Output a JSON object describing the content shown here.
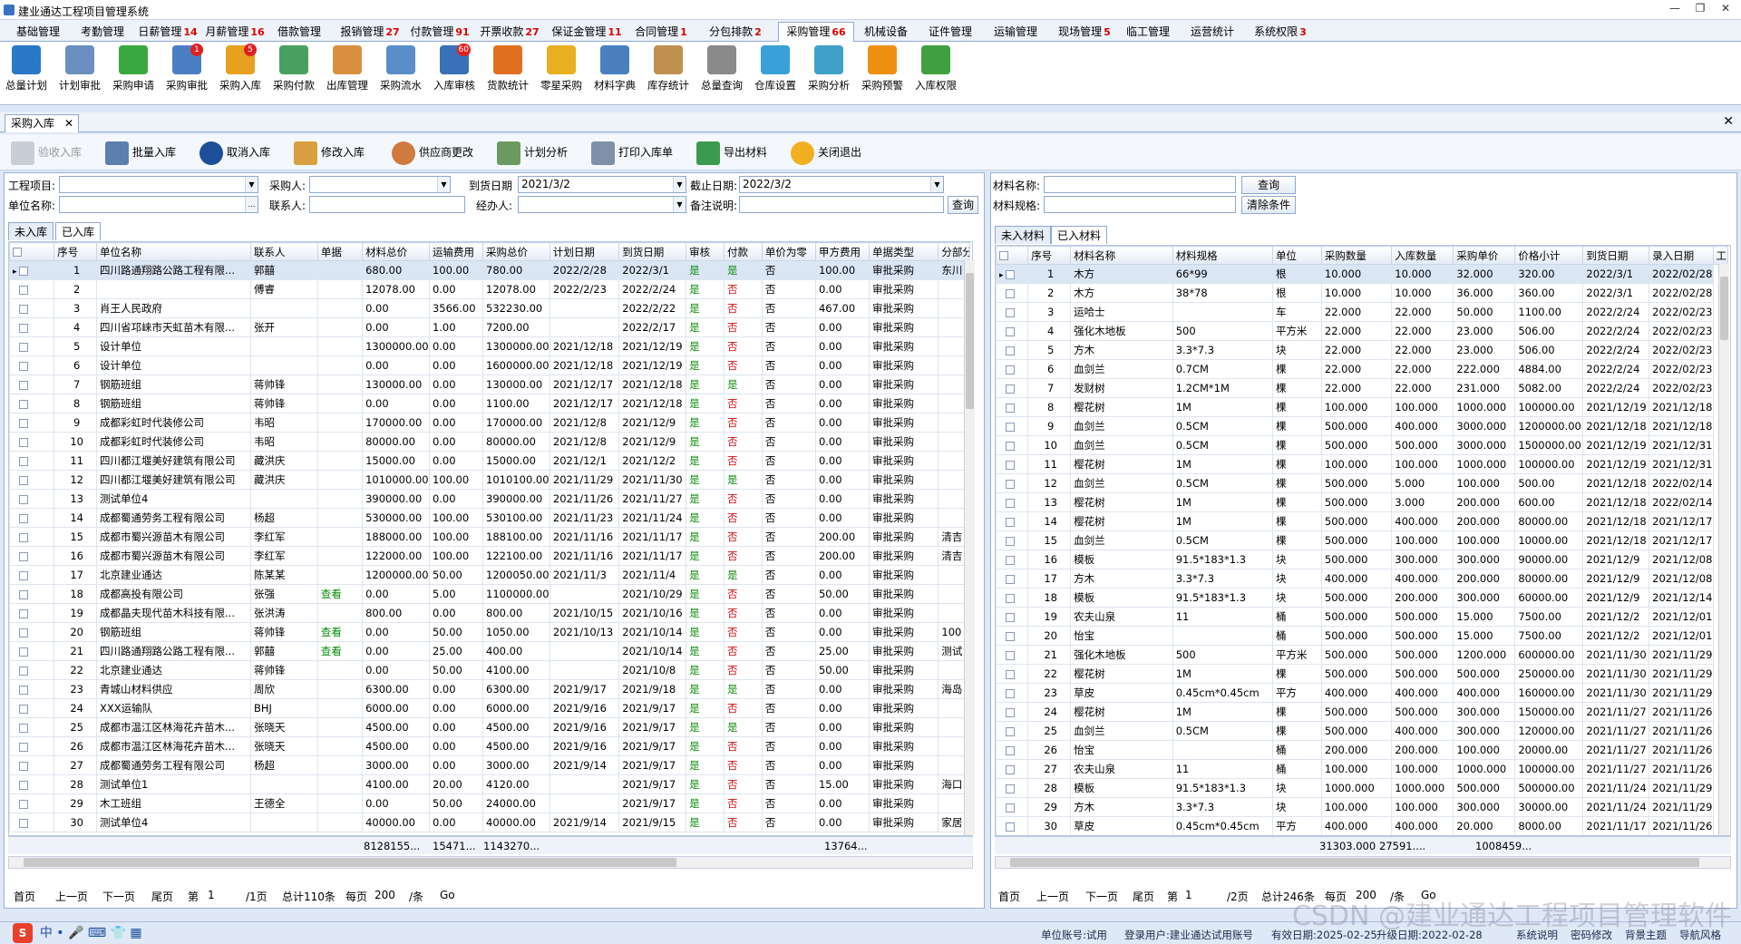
{
  "window": {
    "title": "建业通达工程项目管理系统"
  },
  "menu_tabs": [
    {
      "label": "基础管理",
      "count": ""
    },
    {
      "label": "考勤管理",
      "count": ""
    },
    {
      "label": "日薪管理",
      "count": "14"
    },
    {
      "label": "月薪管理",
      "count": "16"
    },
    {
      "label": "借款管理",
      "count": ""
    },
    {
      "label": "报销管理",
      "count": "27"
    },
    {
      "label": "付款管理",
      "count": "91"
    },
    {
      "label": "开票收款",
      "count": "27"
    },
    {
      "label": "保证金管理",
      "count": "11"
    },
    {
      "label": "合同管理",
      "count": "1"
    },
    {
      "label": "分包排款",
      "count": "2"
    },
    {
      "label": "采购管理",
      "count": "66"
    },
    {
      "label": "机械设备",
      "count": ""
    },
    {
      "label": "证件管理",
      "count": ""
    },
    {
      "label": "运输管理",
      "count": ""
    },
    {
      "label": "现场管理",
      "count": "5"
    },
    {
      "label": "临工管理",
      "count": ""
    },
    {
      "label": "运营统计",
      "count": ""
    },
    {
      "label": "系统权限",
      "count": "3"
    }
  ],
  "ribbon": [
    {
      "label": "总量计划",
      "icon": "clock-icon",
      "color": "#2a78c8",
      "badge": ""
    },
    {
      "label": "计划审批",
      "icon": "document-pen-icon",
      "color": "#6a8fc0",
      "badge": ""
    },
    {
      "label": "采购申请",
      "icon": "add-document-icon",
      "color": "#3aa840",
      "badge": ""
    },
    {
      "label": "采购审批",
      "icon": "approval-icon",
      "color": "#4b7fc4",
      "badge": "1"
    },
    {
      "label": "采购入库",
      "icon": "warehouse-in-icon",
      "color": "#e8a020",
      "badge": "5"
    },
    {
      "label": "采购付款",
      "icon": "payment-icon",
      "color": "#4aa060",
      "badge": ""
    },
    {
      "label": "出库管理",
      "icon": "hand-out-icon",
      "color": "#d89040",
      "badge": ""
    },
    {
      "label": "采购流水",
      "icon": "flow-icon",
      "color": "#5a8ec8",
      "badge": ""
    },
    {
      "label": "入库审核",
      "icon": "audit-icon",
      "color": "#3a70b8",
      "badge": "60"
    },
    {
      "label": "货款统计",
      "icon": "bar-chart-icon",
      "color": "#e07020",
      "badge": ""
    },
    {
      "label": "零星采购",
      "icon": "house-icon",
      "color": "#e8b020",
      "badge": ""
    },
    {
      "label": "材料字典",
      "icon": "tree-icon",
      "color": "#4a80c0",
      "badge": ""
    },
    {
      "label": "库存统计",
      "icon": "clipboard-icon",
      "color": "#c09050",
      "badge": ""
    },
    {
      "label": "总量查询",
      "icon": "list-icon",
      "color": "#8a8a8a",
      "badge": ""
    },
    {
      "label": "仓库设置",
      "icon": "barrel-icon",
      "color": "#3aa0d8",
      "badge": ""
    },
    {
      "label": "采购分析",
      "icon": "pie-chart-icon",
      "color": "#40a0c8",
      "badge": ""
    },
    {
      "label": "采购预警",
      "icon": "warning-icon",
      "color": "#f09010",
      "badge": ""
    },
    {
      "label": "入库权限",
      "icon": "permission-icon",
      "color": "#40a040",
      "badge": ""
    }
  ],
  "doc_tab": {
    "label": "采购入库"
  },
  "toolbar": {
    "verify": "验收入库",
    "batch": "批量入库",
    "cancel": "取消入库",
    "edit": "修改入库",
    "supplier": "供应商更改",
    "plan": "计划分析",
    "print": "打印入库单",
    "export": "导出材料",
    "exit": "关闭退出"
  },
  "filter_left": {
    "project_label": "工程项目:",
    "project_value": "",
    "buyer_label": "采购人:",
    "buyer_value": "",
    "arrive_label": "到货日期",
    "arrive_value": "2021/3/2",
    "end_label": "截止日期:",
    "end_value": "2022/3/2",
    "unit_label": "单位名称:",
    "unit_value": "",
    "contact_label": "联系人:",
    "contact_value": "",
    "handler_label": "经办人:",
    "handler_value": "",
    "remark_label": "备注说明:",
    "remark_value": "",
    "query": "查询"
  },
  "filter_right": {
    "name_label": "材料名称:",
    "spec_label": "材料规格:",
    "query": "查询",
    "clear": "清除条件"
  },
  "left_tabs": [
    "未入库",
    "已入库"
  ],
  "right_tabs": [
    "未入材料",
    "已入材料"
  ],
  "left_grid": {
    "columns": [
      "",
      "序号",
      "单位名称",
      "联系人",
      "单据",
      "材料总价",
      "运输费用",
      "采购总价",
      "计划日期",
      "到货日期",
      "审核",
      "付款",
      "单价为零",
      "甲方费用",
      "单据类型",
      "分部分"
    ],
    "rows": [
      [
        "1",
        "四川路通翔路公路工程有限...",
        "郭囍",
        "",
        "680.00",
        "100.00",
        "780.00",
        "2022/2/28",
        "2022/3/1",
        "是",
        "是",
        "否",
        "100.00",
        "审批采购",
        "东川"
      ],
      [
        "2",
        "",
        "傅睿",
        "",
        "12078.00",
        "0.00",
        "12078.00",
        "2022/2/23",
        "2022/2/24",
        "是",
        "否",
        "否",
        "0.00",
        "审批采购",
        ""
      ],
      [
        "3",
        "肖王人民政府",
        "",
        "",
        "0.00",
        "3566.00",
        "532230.00",
        "",
        "2022/2/22",
        "是",
        "否",
        "否",
        "467.00",
        "审批采购",
        ""
      ],
      [
        "4",
        "四川省邛崃市天虹苗木有限...",
        "张开",
        "",
        "0.00",
        "1.00",
        "7200.00",
        "",
        "2022/2/17",
        "是",
        "否",
        "否",
        "0.00",
        "审批采购",
        ""
      ],
      [
        "5",
        "设计单位",
        "",
        "",
        "1300000.00",
        "0.00",
        "1300000.00",
        "2021/12/18",
        "2021/12/19",
        "是",
        "否",
        "否",
        "0.00",
        "审批采购",
        ""
      ],
      [
        "6",
        "设计单位",
        "",
        "",
        "0.00",
        "0.00",
        "1600000.00",
        "2021/12/18",
        "2021/12/19",
        "是",
        "否",
        "否",
        "0.00",
        "审批采购",
        ""
      ],
      [
        "7",
        "钢筋班组",
        "蒋帅锋",
        "",
        "130000.00",
        "0.00",
        "130000.00",
        "2021/12/17",
        "2021/12/18",
        "是",
        "是",
        "否",
        "0.00",
        "审批采购",
        ""
      ],
      [
        "8",
        "钢筋班组",
        "蒋帅锋",
        "",
        "0.00",
        "0.00",
        "1100.00",
        "2021/12/17",
        "2021/12/18",
        "是",
        "否",
        "否",
        "0.00",
        "审批采购",
        ""
      ],
      [
        "9",
        "成都彩虹时代装修公司",
        "韦昭",
        "",
        "170000.00",
        "0.00",
        "170000.00",
        "2021/12/8",
        "2021/12/9",
        "是",
        "否",
        "否",
        "0.00",
        "审批采购",
        ""
      ],
      [
        "10",
        "成都彩虹时代装修公司",
        "韦昭",
        "",
        "80000.00",
        "0.00",
        "80000.00",
        "2021/12/8",
        "2021/12/9",
        "是",
        "否",
        "否",
        "0.00",
        "审批采购",
        ""
      ],
      [
        "11",
        "四川都江堰美好建筑有限公司",
        "藏洪庆",
        "",
        "15000.00",
        "0.00",
        "15000.00",
        "2021/12/1",
        "2021/12/2",
        "是",
        "否",
        "否",
        "0.00",
        "审批采购",
        ""
      ],
      [
        "12",
        "四川都江堰美好建筑有限公司",
        "藏洪庆",
        "",
        "1010000.00",
        "100.00",
        "1010100.00",
        "2021/11/29",
        "2021/11/30",
        "是",
        "是",
        "否",
        "0.00",
        "审批采购",
        ""
      ],
      [
        "13",
        "测试单位4",
        "",
        "",
        "390000.00",
        "0.00",
        "390000.00",
        "2021/11/26",
        "2021/11/27",
        "是",
        "否",
        "否",
        "0.00",
        "审批采购",
        ""
      ],
      [
        "14",
        "成都蜀通劳务工程有限公司",
        "杨超",
        "",
        "530000.00",
        "100.00",
        "530100.00",
        "2021/11/23",
        "2021/11/24",
        "是",
        "否",
        "否",
        "0.00",
        "审批采购",
        ""
      ],
      [
        "15",
        "成都市蜀兴源苗木有限公司",
        "李红军",
        "",
        "188000.00",
        "100.00",
        "188100.00",
        "2021/11/16",
        "2021/11/17",
        "是",
        "否",
        "否",
        "200.00",
        "审批采购",
        "清吉"
      ],
      [
        "16",
        "成都市蜀兴源苗木有限公司",
        "李红军",
        "",
        "122000.00",
        "100.00",
        "122100.00",
        "2021/11/16",
        "2021/11/17",
        "是",
        "否",
        "否",
        "200.00",
        "审批采购",
        "清吉"
      ],
      [
        "17",
        "北京建业通达",
        "陈某某",
        "",
        "1200000.00",
        "50.00",
        "1200050.00",
        "2021/11/3",
        "2021/11/4",
        "是",
        "是",
        "否",
        "0.00",
        "审批采购",
        ""
      ],
      [
        "18",
        "成都高投有限公司",
        "张强",
        "查看",
        "0.00",
        "5.00",
        "1100000.00",
        "",
        "2021/10/29",
        "是",
        "否",
        "否",
        "50.00",
        "审批采购",
        ""
      ],
      [
        "19",
        "成都晶夫现代苗木科技有限...",
        "张洪涛",
        "",
        "800.00",
        "0.00",
        "800.00",
        "2021/10/15",
        "2021/10/16",
        "是",
        "否",
        "否",
        "0.00",
        "审批采购",
        ""
      ],
      [
        "20",
        "钢筋班组",
        "蒋帅锋",
        "查看",
        "0.00",
        "50.00",
        "1050.00",
        "2021/10/13",
        "2021/10/14",
        "是",
        "否",
        "否",
        "0.00",
        "审批采购",
        "100"
      ],
      [
        "21",
        "四川路通翔路公路工程有限...",
        "郭囍",
        "查看",
        "0.00",
        "25.00",
        "400.00",
        "",
        "2021/10/14",
        "是",
        "否",
        "否",
        "25.00",
        "审批采购",
        "测试"
      ],
      [
        "22",
        "北京建业通达",
        "蒋帅锋",
        "",
        "0.00",
        "50.00",
        "4100.00",
        "",
        "2021/10/8",
        "是",
        "否",
        "否",
        "50.00",
        "审批采购",
        ""
      ],
      [
        "23",
        "青城山材料供应",
        "周欣",
        "",
        "6300.00",
        "0.00",
        "6300.00",
        "2021/9/17",
        "2021/9/18",
        "是",
        "是",
        "否",
        "0.00",
        "审批采购",
        "海岛"
      ],
      [
        "24",
        "XXX运输队",
        "BHJ",
        "",
        "6000.00",
        "0.00",
        "6000.00",
        "2021/9/16",
        "2021/9/17",
        "是",
        "否",
        "否",
        "0.00",
        "审批采购",
        ""
      ],
      [
        "25",
        "成都市温江区林海花卉苗木...",
        "张晓天",
        "",
        "4500.00",
        "0.00",
        "4500.00",
        "2021/9/16",
        "2021/9/17",
        "是",
        "是",
        "否",
        "0.00",
        "审批采购",
        ""
      ],
      [
        "26",
        "成都市温江区林海花卉苗木...",
        "张晓天",
        "",
        "4500.00",
        "0.00",
        "4500.00",
        "2021/9/16",
        "2021/9/17",
        "是",
        "否",
        "否",
        "0.00",
        "审批采购",
        ""
      ],
      [
        "27",
        "成都蜀通劳务工程有限公司",
        "杨超",
        "",
        "3000.00",
        "0.00",
        "3000.00",
        "2021/9/14",
        "2021/9/17",
        "是",
        "否",
        "否",
        "0.00",
        "审批采购",
        ""
      ],
      [
        "28",
        "测试单位1",
        "",
        "",
        "4100.00",
        "20.00",
        "4120.00",
        "",
        "2021/9/17",
        "是",
        "否",
        "否",
        "15.00",
        "审批采购",
        "海口"
      ],
      [
        "29",
        "木工班组",
        "王德全",
        "",
        "0.00",
        "50.00",
        "24000.00",
        "",
        "2021/9/17",
        "是",
        "否",
        "否",
        "0.00",
        "审批采购",
        ""
      ],
      [
        "30",
        "测试单位4",
        "",
        "",
        "40000.00",
        "0.00",
        "40000.00",
        "2021/9/14",
        "2021/9/15",
        "是",
        "否",
        "否",
        "0.00",
        "审批采购",
        "家居"
      ]
    ],
    "sum": {
      "material": "8128155...",
      "freight": "15471...",
      "total": "1143270...",
      "party_a": "13764..."
    }
  },
  "left_pager": {
    "first": "首页",
    "prev": "上一页",
    "next": "下一页",
    "last": "尾页",
    "page_label": "第",
    "page": "1",
    "pages": "/1页",
    "total": "总计110条",
    "per_label": "每页",
    "per": "200",
    "per_unit": "/条",
    "go": "Go"
  },
  "right_grid": {
    "columns": [
      "",
      "序号",
      "材料名称",
      "材料规格",
      "单位",
      "采购数量",
      "入库数量",
      "采购单价",
      "价格小计",
      "到货日期",
      "录入日期",
      "工"
    ],
    "rows": [
      [
        "1",
        "木方",
        "66*99",
        "根",
        "10.000",
        "10.000",
        "32.000",
        "320.00",
        "2022/3/1",
        "2022/02/28"
      ],
      [
        "2",
        "木方",
        "38*78",
        "根",
        "10.000",
        "10.000",
        "36.000",
        "360.00",
        "2022/3/1",
        "2022/02/28"
      ],
      [
        "3",
        "运哈士",
        "",
        "车",
        "22.000",
        "22.000",
        "50.000",
        "1100.00",
        "2022/2/24",
        "2022/02/23"
      ],
      [
        "4",
        "强化木地板",
        "500",
        "平方米",
        "22.000",
        "22.000",
        "23.000",
        "506.00",
        "2022/2/24",
        "2022/02/23"
      ],
      [
        "5",
        "方木",
        "3.3*7.3",
        "块",
        "22.000",
        "22.000",
        "23.000",
        "506.00",
        "2022/2/24",
        "2022/02/23"
      ],
      [
        "6",
        "血剑兰",
        "0.7CM",
        "棵",
        "22.000",
        "22.000",
        "222.000",
        "4884.00",
        "2022/2/24",
        "2022/02/23"
      ],
      [
        "7",
        "发财树",
        "1.2CM*1M",
        "棵",
        "22.000",
        "22.000",
        "231.000",
        "5082.00",
        "2022/2/24",
        "2022/02/23"
      ],
      [
        "8",
        "樱花树",
        "1M",
        "棵",
        "100.000",
        "100.000",
        "1000.000",
        "100000.00",
        "2021/12/19",
        "2021/12/18"
      ],
      [
        "9",
        "血剑兰",
        "0.5CM",
        "棵",
        "500.000",
        "400.000",
        "3000.000",
        "1200000.00",
        "2021/12/18",
        "2021/12/18"
      ],
      [
        "10",
        "血剑兰",
        "0.5CM",
        "棵",
        "500.000",
        "500.000",
        "3000.000",
        "1500000.00",
        "2021/12/19",
        "2021/12/31"
      ],
      [
        "11",
        "樱花树",
        "1M",
        "棵",
        "100.000",
        "100.000",
        "1000.000",
        "100000.00",
        "2021/12/19",
        "2021/12/31"
      ],
      [
        "12",
        "血剑兰",
        "0.5CM",
        "棵",
        "500.000",
        "5.000",
        "100.000",
        "500.00",
        "2021/12/18",
        "2022/02/14"
      ],
      [
        "13",
        "樱花树",
        "1M",
        "棵",
        "500.000",
        "3.000",
        "200.000",
        "600.00",
        "2021/12/18",
        "2022/02/14"
      ],
      [
        "14",
        "樱花树",
        "1M",
        "棵",
        "500.000",
        "400.000",
        "200.000",
        "80000.00",
        "2021/12/18",
        "2021/12/17"
      ],
      [
        "15",
        "血剑兰",
        "0.5CM",
        "棵",
        "500.000",
        "100.000",
        "100.000",
        "10000.00",
        "2021/12/18",
        "2021/12/17"
      ],
      [
        "16",
        "模板",
        "91.5*183*1.3",
        "块",
        "500.000",
        "300.000",
        "300.000",
        "90000.00",
        "2021/12/9",
        "2021/12/08"
      ],
      [
        "17",
        "方木",
        "3.3*7.3",
        "块",
        "400.000",
        "400.000",
        "200.000",
        "80000.00",
        "2021/12/9",
        "2021/12/08"
      ],
      [
        "18",
        "模板",
        "91.5*183*1.3",
        "块",
        "500.000",
        "200.000",
        "300.000",
        "60000.00",
        "2021/12/9",
        "2021/12/14"
      ],
      [
        "19",
        "农夫山泉",
        "11",
        "桶",
        "500.000",
        "500.000",
        "15.000",
        "7500.00",
        "2021/12/2",
        "2021/12/01"
      ],
      [
        "20",
        "怡宝",
        "",
        "桶",
        "500.000",
        "500.000",
        "15.000",
        "7500.00",
        "2021/12/2",
        "2021/12/01"
      ],
      [
        "21",
        "强化木地板",
        "500",
        "平方米",
        "500.000",
        "500.000",
        "1200.000",
        "600000.00",
        "2021/11/30",
        "2021/11/29"
      ],
      [
        "22",
        "樱花树",
        "1M",
        "棵",
        "500.000",
        "500.000",
        "500.000",
        "250000.00",
        "2021/11/30",
        "2021/11/29"
      ],
      [
        "23",
        "草皮",
        "0.45cm*0.45cm",
        "平方",
        "400.000",
        "400.000",
        "400.000",
        "160000.00",
        "2021/11/30",
        "2021/11/29"
      ],
      [
        "24",
        "樱花树",
        "1M",
        "棵",
        "500.000",
        "500.000",
        "300.000",
        "150000.00",
        "2021/11/27",
        "2021/11/26"
      ],
      [
        "25",
        "血剑兰",
        "0.5CM",
        "棵",
        "500.000",
        "400.000",
        "300.000",
        "120000.00",
        "2021/11/27",
        "2021/11/26"
      ],
      [
        "26",
        "怡宝",
        "",
        "桶",
        "200.000",
        "200.000",
        "100.000",
        "20000.00",
        "2021/11/27",
        "2021/11/26"
      ],
      [
        "27",
        "农夫山泉",
        "11",
        "桶",
        "100.000",
        "100.000",
        "1000.000",
        "100000.00",
        "2021/11/27",
        "2021/11/26"
      ],
      [
        "28",
        "模板",
        "91.5*183*1.3",
        "块",
        "1000.000",
        "1000.000",
        "500.000",
        "500000.00",
        "2021/11/24",
        "2021/11/29"
      ],
      [
        "29",
        "方木",
        "3.3*7.3",
        "块",
        "100.000",
        "100.000",
        "300.000",
        "30000.00",
        "2021/11/24",
        "2021/11/29"
      ],
      [
        "30",
        "草皮",
        "0.45cm*0.45cm",
        "平方",
        "400.000",
        "400.000",
        "20.000",
        "8000.00",
        "2021/11/17",
        "2021/11/26"
      ]
    ],
    "sum": {
      "qty": "31303.000",
      "in_qty": "27591....",
      "subtotal": "1008459..."
    }
  },
  "right_pager": {
    "first": "首页",
    "prev": "上一页",
    "next": "下一页",
    "last": "尾页",
    "page_label": "第",
    "page": "1",
    "pages": "/2页",
    "total": "总计246条",
    "per_label": "每页",
    "per": "200",
    "per_unit": "/条",
    "go": "Go"
  },
  "status": {
    "account": "单位账号:试用",
    "user": "登录用户:建业通达试用账号",
    "valid": "有效日期:2025-02-25",
    "upgrade": "升级日期:2022-02-28",
    "sys": "系统说明",
    "pwd": "密码修改",
    "theme": "背景主题",
    "nav": "导航风格"
  },
  "watermark": "CSDN @建业通达工程项目管理软件"
}
